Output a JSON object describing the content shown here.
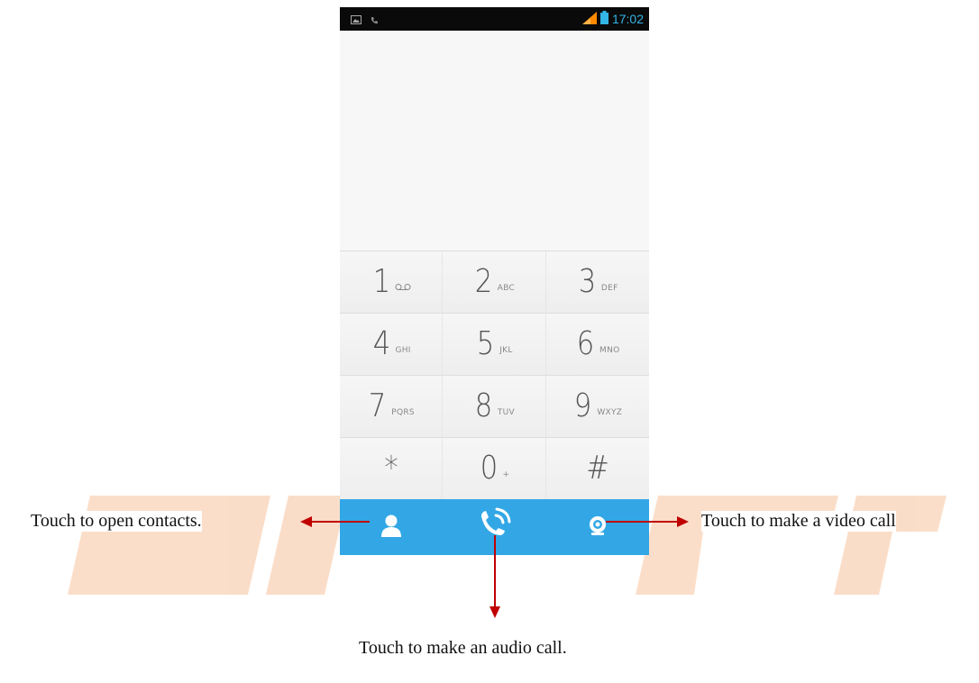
{
  "status_bar": {
    "time": "17:02",
    "notification_icons": [
      "image-icon",
      "phone-notification-icon"
    ],
    "system_icons": [
      "signal-icon",
      "battery-icon"
    ]
  },
  "dialpad": {
    "keys": [
      {
        "digit": "1",
        "letters": "",
        "icon": "voicemail-icon"
      },
      {
        "digit": "2",
        "letters": "ABC"
      },
      {
        "digit": "3",
        "letters": "DEF"
      },
      {
        "digit": "4",
        "letters": "GHI"
      },
      {
        "digit": "5",
        "letters": "JKL"
      },
      {
        "digit": "6",
        "letters": "MNO"
      },
      {
        "digit": "7",
        "letters": "PQRS"
      },
      {
        "digit": "8",
        "letters": "TUV"
      },
      {
        "digit": "9",
        "letters": "WXYZ"
      },
      {
        "digit": "*",
        "letters": ""
      },
      {
        "digit": "0",
        "letters": "+"
      },
      {
        "digit": "#",
        "letters": ""
      }
    ]
  },
  "actions": {
    "contacts_icon": "contact-person-icon",
    "audio_call_icon": "phone-call-icon",
    "video_call_icon": "video-camera-icon"
  },
  "annotations": {
    "contacts": "Touch to open contacts.",
    "video": "Touch to make a video call",
    "audio": "Touch to make an audio call."
  },
  "colors": {
    "action_bar": "#33a7e6",
    "status_accent": "#33b5e5",
    "arrow": "#c00000",
    "watermark": "#f3a064"
  }
}
